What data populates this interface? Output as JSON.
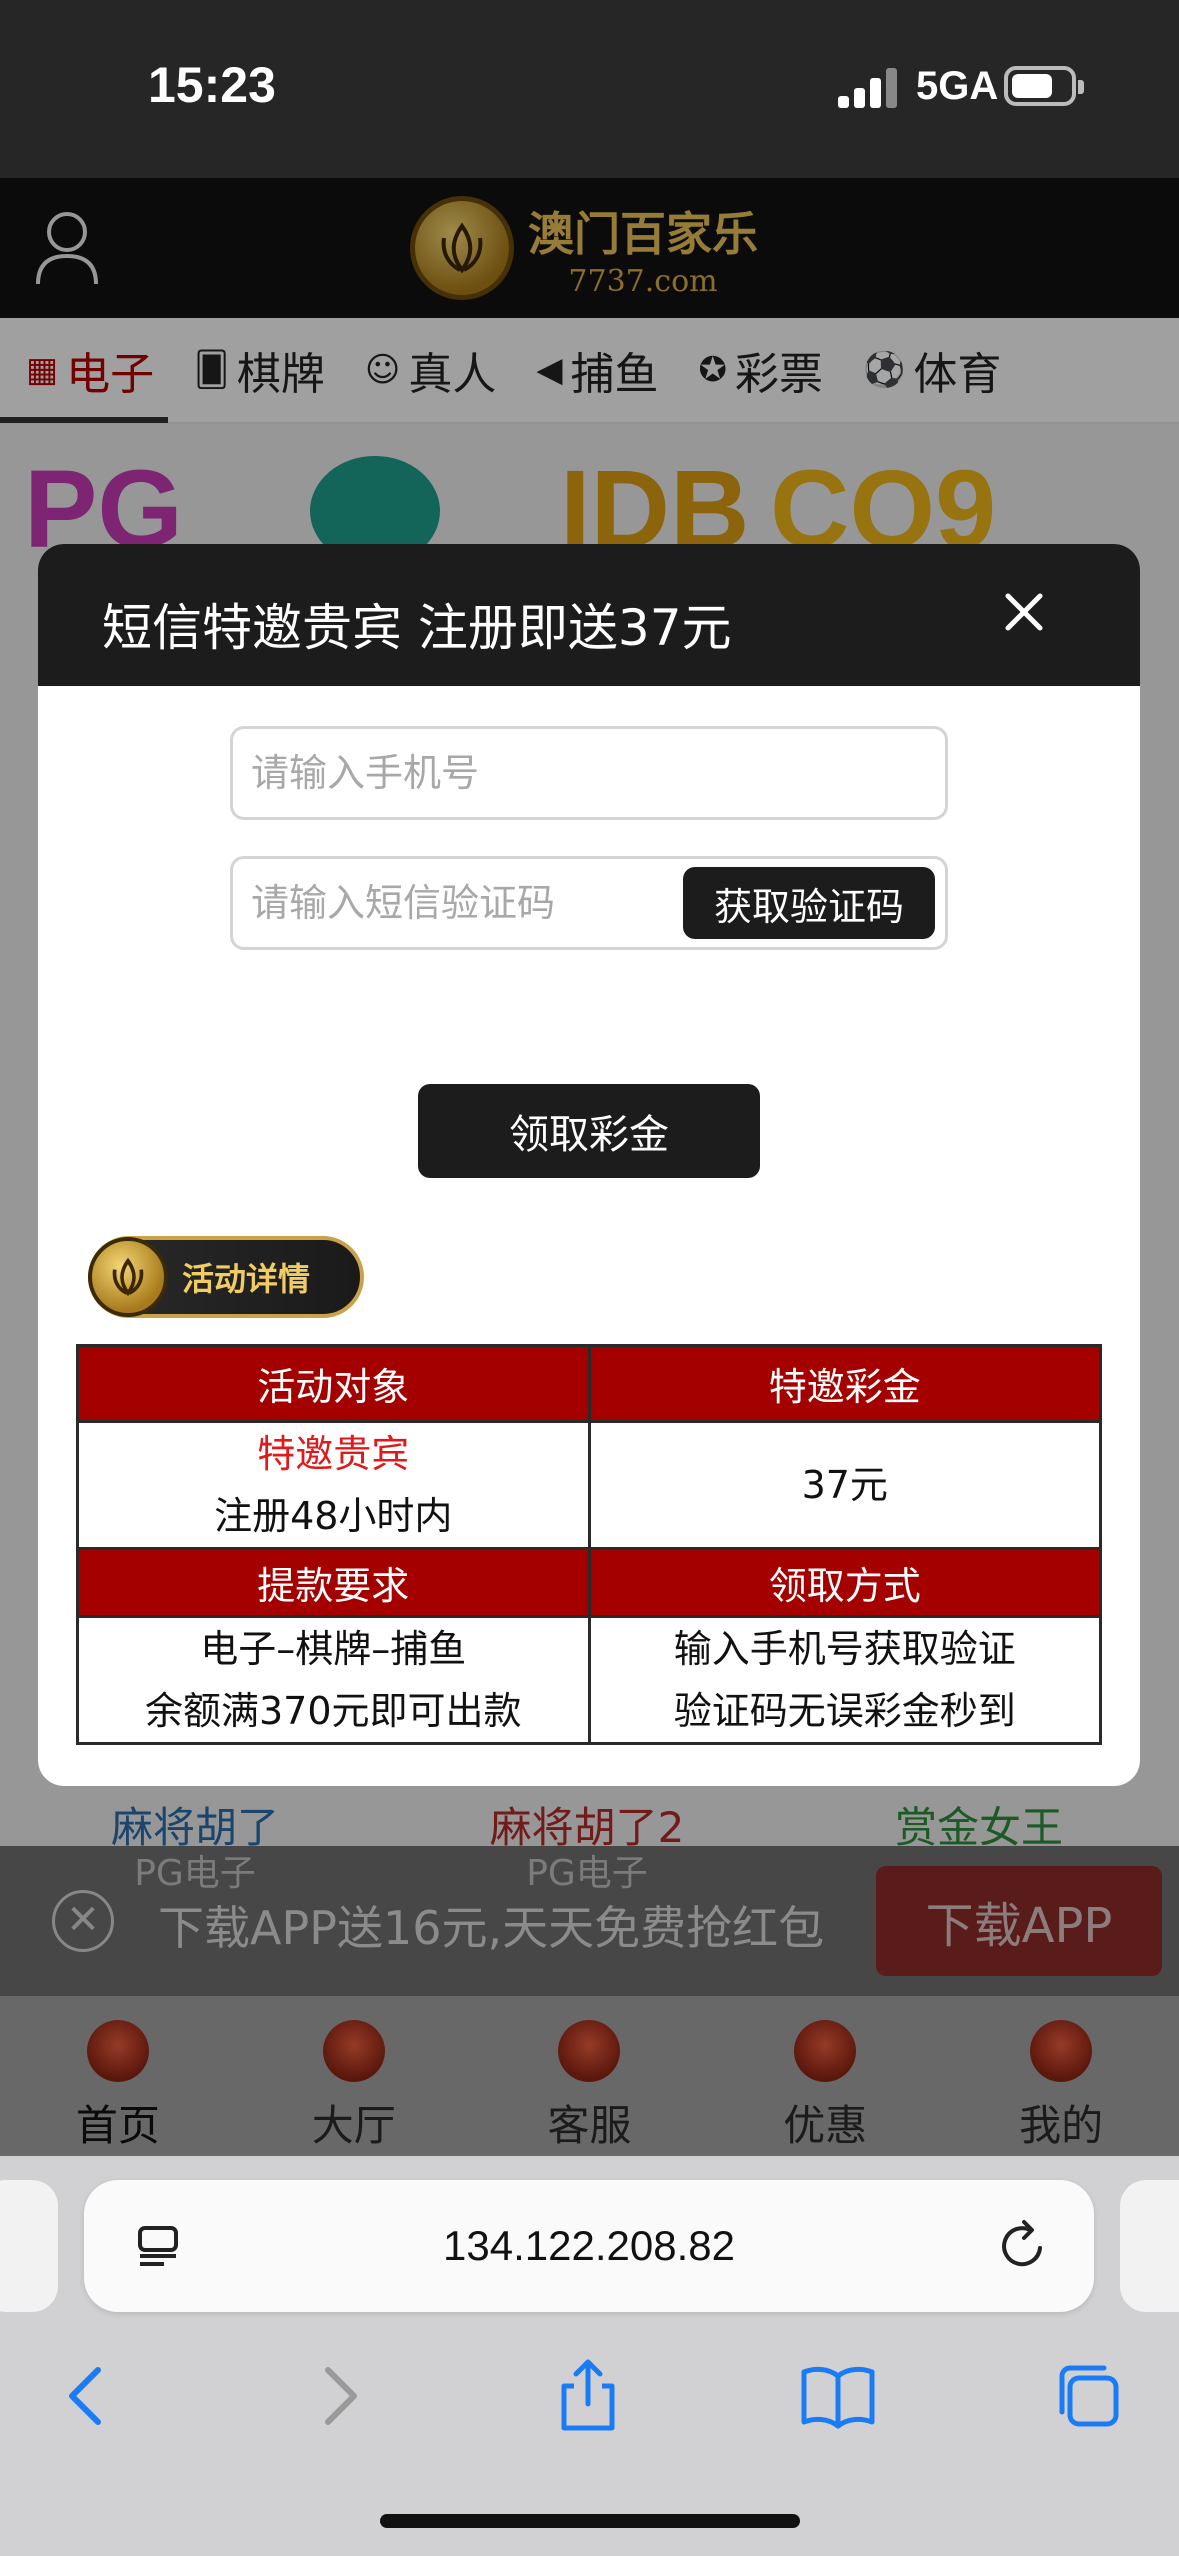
{
  "status_bar": {
    "time": "15:23",
    "network": "5GA"
  },
  "site_header": {
    "logo_title": "澳门百家乐",
    "logo_sub": "7737.com"
  },
  "categories": [
    {
      "label": "电子",
      "icon": "slot-icon",
      "active": true
    },
    {
      "label": "棋牌",
      "icon": "cards-icon"
    },
    {
      "label": "真人",
      "icon": "dealer-icon"
    },
    {
      "label": "捕鱼",
      "icon": "fish-icon"
    },
    {
      "label": "彩票",
      "icon": "lottery-icon"
    },
    {
      "label": "体育",
      "icon": "soccer-ball-icon"
    }
  ],
  "brands": [
    "PG",
    "IDB",
    "CQ9"
  ],
  "games": [
    {
      "name": "麻将胡了",
      "provider": "PG电子",
      "color": "#2b6aa8"
    },
    {
      "name": "麻将胡了2",
      "provider": "PG电子",
      "color": "#b02a2a"
    },
    {
      "name": "赏金女王",
      "provider": "",
      "color": "#2c8a3a"
    }
  ],
  "download_banner": {
    "text": "下载APP送16元,天天免费抢红包",
    "button": "下载APP"
  },
  "tabs": [
    {
      "label": "首页",
      "icon": "home-icon",
      "active": true
    },
    {
      "label": "大厅",
      "icon": "lobby-icon"
    },
    {
      "label": "客服",
      "icon": "support-icon"
    },
    {
      "label": "优惠",
      "icon": "promo-icon"
    },
    {
      "label": "我的",
      "icon": "profile-icon"
    }
  ],
  "browser": {
    "url": "134.122.208.82"
  },
  "modal": {
    "title": "短信特邀贵宾 注册即送37元",
    "phone_placeholder": "请输入手机号",
    "code_placeholder": "请输入短信验证码",
    "get_code": "获取验证码",
    "claim": "领取彩金",
    "badge": "活动详情",
    "table": {
      "h1": "活动对象",
      "h2": "特邀彩金",
      "r1c1a": "特邀贵宾",
      "r1c1b": "注册48小时内",
      "r1c2": "37元",
      "h3": "提款要求",
      "h4": "领取方式",
      "r2c1a": "电子–棋牌–捕鱼",
      "r2c1b": "余额满370元即可出款",
      "r2c2a": "输入手机号获取验证",
      "r2c2b": "验证码无误彩金秒到"
    }
  },
  "colors": {
    "accent_red": "#a50000",
    "dark": "#1c1c1c",
    "gold": "#e7bf54"
  }
}
